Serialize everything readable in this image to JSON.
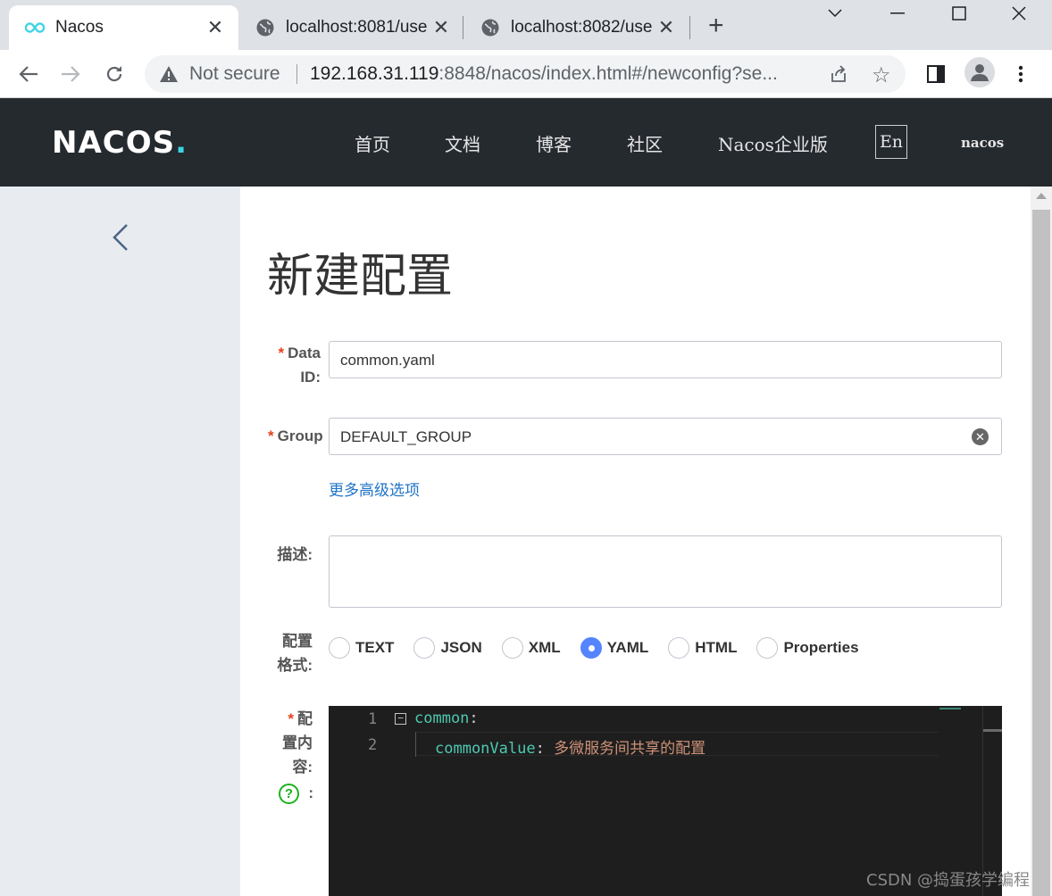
{
  "browser": {
    "tabs": [
      {
        "label": "Nacos",
        "icon": "nacos-logo-icon",
        "active": true
      },
      {
        "label": "localhost:8081/use",
        "icon": "globe-icon",
        "active": false
      },
      {
        "label": "localhost:8082/use",
        "icon": "globe-icon",
        "active": false
      }
    ],
    "tab_close": "✕",
    "not_secure": "Not secure",
    "url_host": "192.168.31.119",
    "url_rest": ":8848/nacos/index.html#/newconfig?se..."
  },
  "header": {
    "logo": {
      "main": "NACOS",
      "dot": "."
    },
    "menu": [
      "首页",
      "文档",
      "博客",
      "社区",
      "Nacos企业版"
    ],
    "lang": "En",
    "user": "nacos"
  },
  "page": {
    "title": "新建配置",
    "data_id": {
      "required": "*",
      "label_line1": "Data",
      "label_line2": "ID:",
      "value": "common.yaml"
    },
    "group": {
      "required": "*",
      "label": "Group",
      "value": "DEFAULT_GROUP"
    },
    "advanced_link": "更多高级选项",
    "description": {
      "label": "描述:",
      "value": ""
    },
    "format": {
      "label_line1": "配置",
      "label_line2": "格式:",
      "options": [
        "TEXT",
        "JSON",
        "XML",
        "YAML",
        "HTML",
        "Properties"
      ],
      "selected": "YAML"
    },
    "content": {
      "required": "*",
      "label_line1": "配",
      "label_line2": "置内",
      "label_line3": "容:",
      "help": "?",
      "colon": ":",
      "lines": [
        {
          "num": "1",
          "key": "common",
          "sep": ":",
          "value": ""
        },
        {
          "num": "2",
          "key": "commonValue",
          "sep": ": ",
          "value": "多微服务间共享的配置"
        }
      ]
    }
  },
  "watermark": "CSDN @捣蛋孩学编程"
}
